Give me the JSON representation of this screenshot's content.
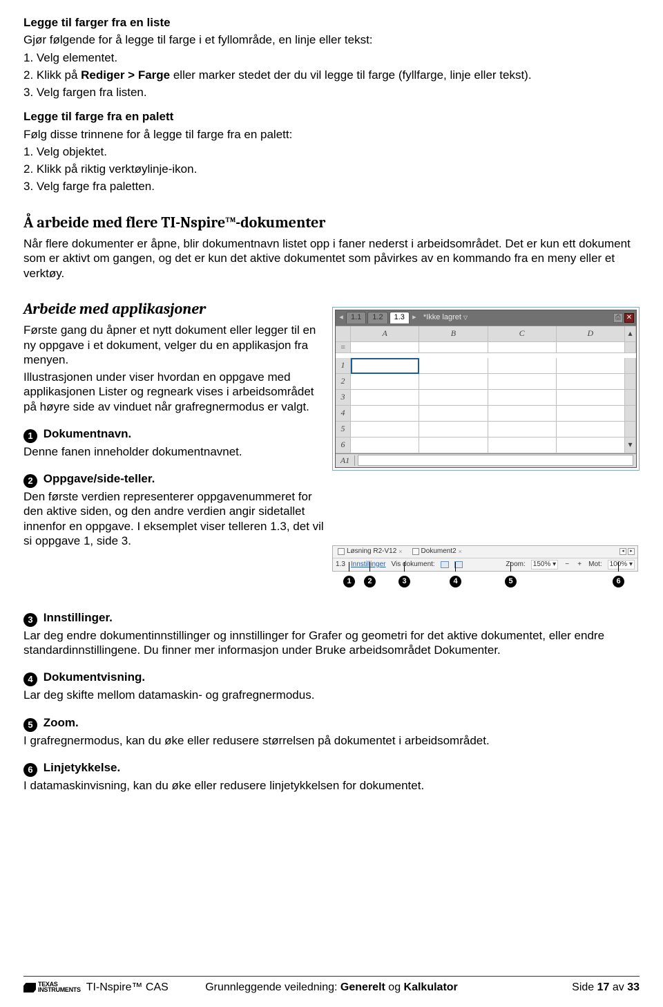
{
  "sec1": {
    "title": "Legge til farger fra en liste",
    "intro": "Gjør følgende for å legge til farge i et fyllområde, en linje eller tekst:",
    "s1": "1. Velg elementet.",
    "s2a": "2. Klikk på ",
    "s2b": "Rediger > Farge",
    "s2c": " eller marker stedet der du vil legge til farge (fyllfarge, linje eller tekst).",
    "s3": "3. Velg fargen fra listen."
  },
  "sec2": {
    "title": "Legge til farge fra en palett",
    "intro": "Følg disse trinnene for å legge til farge fra en palett:",
    "s1": "1. Velg objektet.",
    "s2": "2. Klikk på riktig verktøylinje-ikon.",
    "s3": "3. Velg farge fra paletten."
  },
  "h2a": "Å arbeide med flere TI-Nspire™-dokumenter",
  "p2a": "Når flere dokumenter er åpne, blir dokumentnavn listet opp i faner nederst i arbeidsområdet. Det er kun ett dokument som er aktivt om gangen, og det er kun det aktive dokumentet som påvirkes av en kommando fra en meny eller et verktøy.",
  "h2b": "Arbeide med applikasjoner",
  "p2b1": "Første gang du åpner et nytt dokument eller legger til en ny oppgave i et dokument, velger du en applikasjon fra menyen.",
  "p2b2": "Illustrasjonen under viser hvordan en oppgave med applikasjonen Lister og regneark vises i arbeidsområdet på høyre side av vinduet når grafregnermodus er valgt.",
  "items": {
    "i1": {
      "t": "Dokumentnavn.",
      "d": "Denne fanen inneholder dokumentnavnet."
    },
    "i2": {
      "t": "Oppgave/side-teller.",
      "d": "Den første verdien representerer oppgavenummeret for den aktive siden, og den andre verdien angir sidetallet innenfor en oppgave. I eksemplet viser telleren 1.3, det vil si oppgave 1, side 3."
    },
    "i3": {
      "t": "Innstillinger.",
      "d1": "Lar deg endre dokumentinnstillinger og innstillinger for Grafer og geometri for det aktive dokumentet, eller endre standardinnstillingene. Du finner mer informasjon under ",
      "d2": "Bruke arbeidsområdet Dokumenter."
    },
    "i4": {
      "t": "Dokumentvisning.",
      "d": "Lar deg skifte mellom datamaskin- og grafregnermodus."
    },
    "i5": {
      "t": "Zoom.",
      "d": "I grafregnermodus, kan du øke eller redusere størrelsen på dokumentet i arbeidsområdet."
    },
    "i6": {
      "t": "Linjetykkelse.",
      "d": "I datamaskinvisning, kan du øke eller redusere linjetykkelsen for dokumentet."
    }
  },
  "mock": {
    "tabs": [
      "1.1",
      "1.2",
      "1.3"
    ],
    "title": "*Ikke lagret",
    "cols": [
      "A",
      "B",
      "C",
      "D"
    ],
    "rows": [
      "1",
      "2",
      "3",
      "4",
      "5",
      "6"
    ],
    "cellref": "A1"
  },
  "status": {
    "doc1": "Løsning R2-V12",
    "doc2": "Dokument2",
    "x": "×",
    "back": "◂",
    "fwd": "▸",
    "pg": "1.3",
    "set": "Innstillinger",
    "vd": "Vis dokument:",
    "zl": "Zoom:",
    "zv": "150%",
    "minus": "−",
    "plus": "+",
    "ml": "Mot:",
    "mv": "100%"
  },
  "nums": {
    "n1": "1",
    "n2": "2",
    "n3": "3",
    "n4": "4",
    "n5": "5",
    "n6": "6"
  },
  "footer": {
    "brand": "TEXAS INSTRUMENTS",
    "left": "TI-Nspire™ CAS",
    "mid1": "Grunnleggende veiledning: ",
    "mid2": "Generelt",
    "mid3": " og ",
    "mid4": "Kalkulator",
    "right1": "Side ",
    "right2": "17",
    "right3": " av ",
    "right4": "33"
  }
}
